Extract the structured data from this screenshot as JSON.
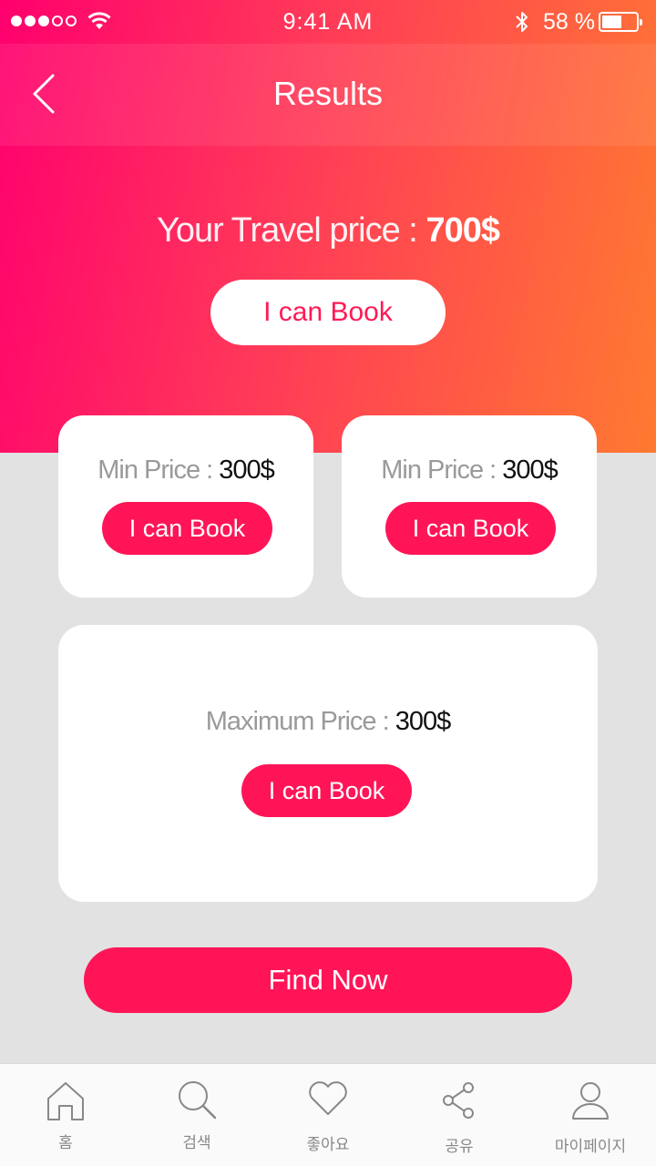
{
  "status_bar": {
    "time": "9:41 AM",
    "battery_text": "58 %",
    "battery_level": 0.58,
    "icons": [
      "signal-dots-icon",
      "wifi-icon",
      "bluetooth-icon",
      "battery-icon"
    ]
  },
  "header": {
    "title": "Results",
    "back_icon": "chevron-left-icon"
  },
  "hero": {
    "label": "Your Travel price : ",
    "value": "700$",
    "button_label": "I can Book"
  },
  "cards": {
    "min_left": {
      "label": "Min Price : ",
      "value": "300$",
      "button_label": "I can Book"
    },
    "min_right": {
      "label": "Min Price : ",
      "value": "300$",
      "button_label": "I can Book"
    },
    "max": {
      "label": "Maximum Price : ",
      "value": "300$",
      "button_label": "I can Book"
    }
  },
  "find_button_label": "Find Now",
  "tabs": [
    {
      "label": "홈",
      "icon": "home-icon"
    },
    {
      "label": "검색",
      "icon": "search-icon"
    },
    {
      "label": "좋아요",
      "icon": "heart-icon"
    },
    {
      "label": "공유",
      "icon": "share-icon"
    },
    {
      "label": "마이페이지",
      "icon": "user-icon"
    }
  ],
  "colors": {
    "accent": "#ff1557",
    "gradient_start": "#ff006e",
    "gradient_end": "#ff7a30",
    "background": "#e2e2e2"
  }
}
